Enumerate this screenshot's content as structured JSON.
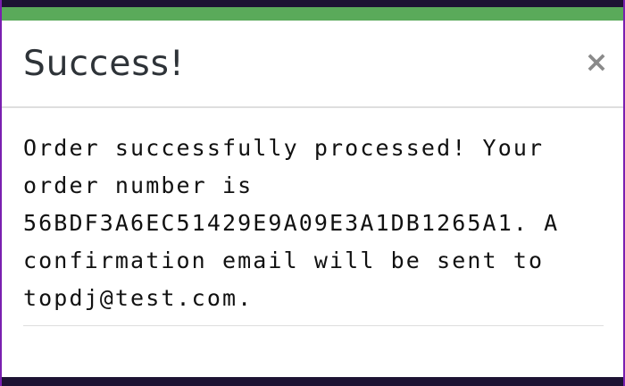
{
  "modal": {
    "title": "Success!",
    "close_icon": "close-icon",
    "close_glyph": "×",
    "message_lines": [
      "Order successfully processed! Your",
      "order number is",
      "56BDF3A6EC51429E9A09E3A1DB1265A1. A",
      "confirmation email will be sent to",
      "topdj@test.com."
    ]
  },
  "colors": {
    "accent": "#5aaa5a",
    "backdrop": "#1d1333",
    "edge": "#7a1fb0",
    "title": "#2e3338",
    "close": "#8a8a8a",
    "text": "#111111"
  }
}
